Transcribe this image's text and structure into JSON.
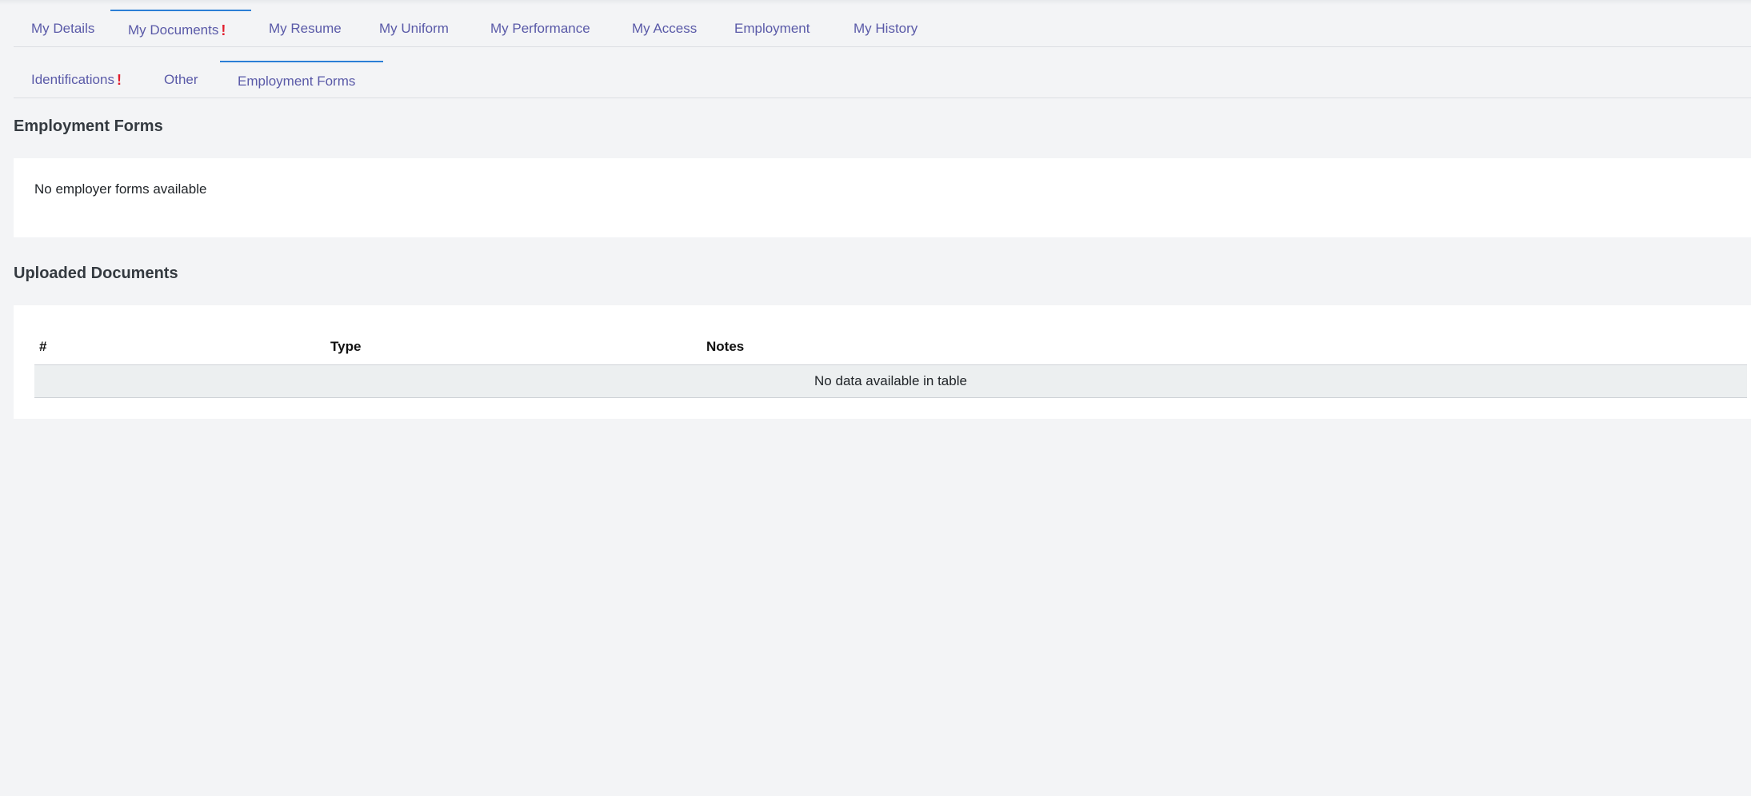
{
  "main_tabs": [
    {
      "label": "My Details",
      "alert": ""
    },
    {
      "label": "My Documents",
      "alert": "!"
    },
    {
      "label": "My Resume",
      "alert": ""
    },
    {
      "label": "My Uniform",
      "alert": ""
    },
    {
      "label": "My Performance",
      "alert": ""
    },
    {
      "label": "My Access",
      "alert": ""
    },
    {
      "label": "Employment",
      "alert": ""
    },
    {
      "label": "My History",
      "alert": ""
    }
  ],
  "sub_tabs": [
    {
      "label": "Identifications",
      "alert": "!"
    },
    {
      "label": "Other",
      "alert": ""
    },
    {
      "label": "Employment Forms",
      "alert": ""
    }
  ],
  "employment_forms": {
    "title": "Employment Forms",
    "empty_message": "No employer forms available"
  },
  "uploaded_documents": {
    "title": "Uploaded Documents",
    "columns": [
      "#",
      "Type",
      "Notes"
    ],
    "empty_message": "No data available in table"
  },
  "colors": {
    "tab_text": "#5a5aa8",
    "active_indicator": "#2b7fd6",
    "alert": "#e11d2c"
  }
}
